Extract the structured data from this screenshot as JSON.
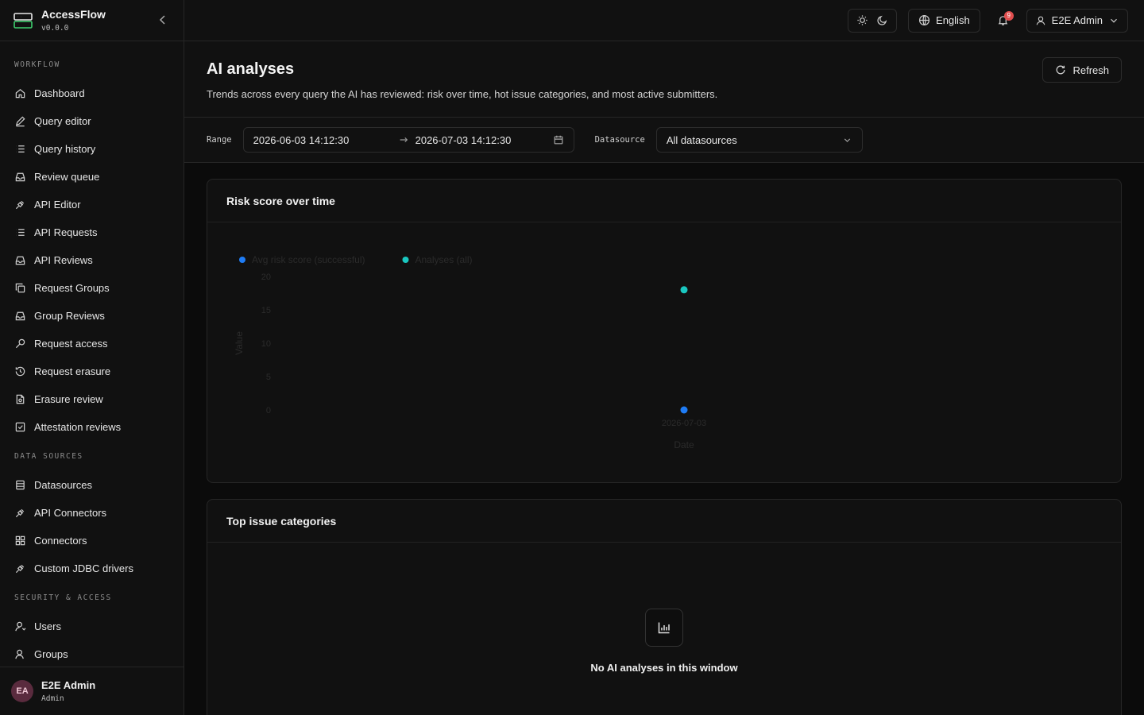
{
  "brand": {
    "name": "AccessFlow",
    "version": "v0.0.0"
  },
  "sidebar": {
    "sections": [
      {
        "label": "WORKFLOW",
        "items": [
          {
            "label": "Dashboard",
            "icon": "home-icon"
          },
          {
            "label": "Query editor",
            "icon": "pencil-icon"
          },
          {
            "label": "Query history",
            "icon": "list-icon"
          },
          {
            "label": "Review queue",
            "icon": "inbox-icon"
          },
          {
            "label": "API Editor",
            "icon": "plug-icon"
          },
          {
            "label": "API Requests",
            "icon": "list-icon"
          },
          {
            "label": "API Reviews",
            "icon": "inbox-icon"
          },
          {
            "label": "Request Groups",
            "icon": "copy-icon"
          },
          {
            "label": "Group Reviews",
            "icon": "inbox-icon"
          },
          {
            "label": "Request access",
            "icon": "key-icon"
          },
          {
            "label": "Request erasure",
            "icon": "history-icon"
          },
          {
            "label": "Erasure review",
            "icon": "file-search-icon"
          },
          {
            "label": "Attestation reviews",
            "icon": "check-square-icon"
          }
        ]
      },
      {
        "label": "DATA SOURCES",
        "items": [
          {
            "label": "Datasources",
            "icon": "database-icon"
          },
          {
            "label": "API Connectors",
            "icon": "plug-icon"
          },
          {
            "label": "Connectors",
            "icon": "grid-icon"
          },
          {
            "label": "Custom JDBC drivers",
            "icon": "plug-icon"
          }
        ]
      },
      {
        "label": "SECURITY & ACCESS",
        "items": [
          {
            "label": "Users",
            "icon": "user-icon"
          },
          {
            "label": "Groups",
            "icon": "users-icon"
          }
        ]
      }
    ],
    "footer": {
      "initials": "EA",
      "name": "E2E Admin",
      "role": "Admin"
    }
  },
  "topbar": {
    "language": "English",
    "notifications": "9",
    "user": "E2E Admin"
  },
  "page": {
    "title": "AI analyses",
    "subtitle": "Trends across every query the AI has reviewed: risk over time, hot issue categories, and most active submitters.",
    "refresh_label": "Refresh"
  },
  "filters": {
    "range_label": "Range",
    "range_start": "2026-06-03 14:12:30",
    "range_end": "2026-07-03 14:12:30",
    "datasource_label": "Datasource",
    "datasource_value": "All datasources"
  },
  "risk_card": {
    "title": "Risk score over time"
  },
  "chart_data": {
    "type": "scatter",
    "title": "Risk score over time",
    "xlabel": "Date",
    "ylabel": "Value",
    "ylim": [
      0,
      20
    ],
    "y_ticks": [
      "20",
      "15",
      "10",
      "5",
      "0"
    ],
    "categories": [
      "2026-07-03"
    ],
    "legend_position": "top-left",
    "series": [
      {
        "name": "Avg risk score (successful)",
        "color": "#1f7cf5",
        "values": [
          0
        ]
      },
      {
        "name": "Analyses (all)",
        "color": "#1ac7c0",
        "values": [
          18
        ]
      }
    ]
  },
  "issues_card": {
    "title": "Top issue categories",
    "empty_text": "No AI analyses in this window",
    "empty_icon": "bar-chart-icon"
  }
}
